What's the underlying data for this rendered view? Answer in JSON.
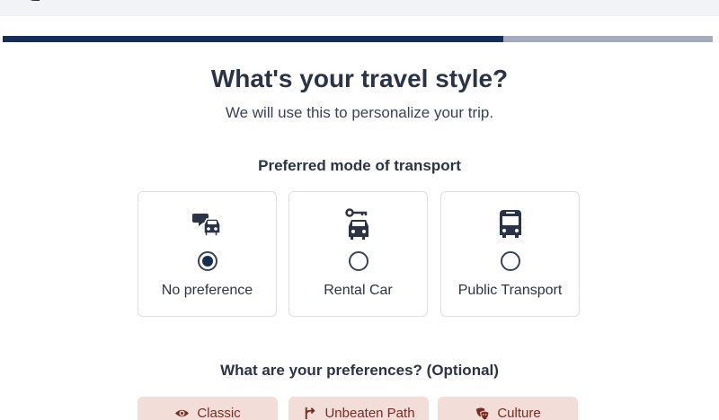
{
  "progress": {
    "fraction": 0.705
  },
  "header": {
    "title": "What's your travel style?",
    "subtitle": "We will use this to personalize your trip."
  },
  "transport": {
    "label": "Preferred mode of transport",
    "options": [
      {
        "label": "No preference",
        "icon": "car-and-chat-icon",
        "selected": true
      },
      {
        "label": "Rental Car",
        "icon": "car-with-key-icon",
        "selected": false
      },
      {
        "label": "Public Transport",
        "icon": "bus-icon",
        "selected": false
      }
    ]
  },
  "preferences": {
    "label": "What are your preferences? (Optional)",
    "chips": [
      {
        "label": "Classic",
        "icon": "eye-icon"
      },
      {
        "label": "Unbeaten Path",
        "icon": "signpost-icon"
      },
      {
        "label": "Culture",
        "icon": "masks-icon"
      }
    ]
  },
  "colors": {
    "accent": "#172d55",
    "progress_track": "#a4acbb",
    "chip_background": "#f2ddd8",
    "chip_text": "#7c2b22"
  }
}
